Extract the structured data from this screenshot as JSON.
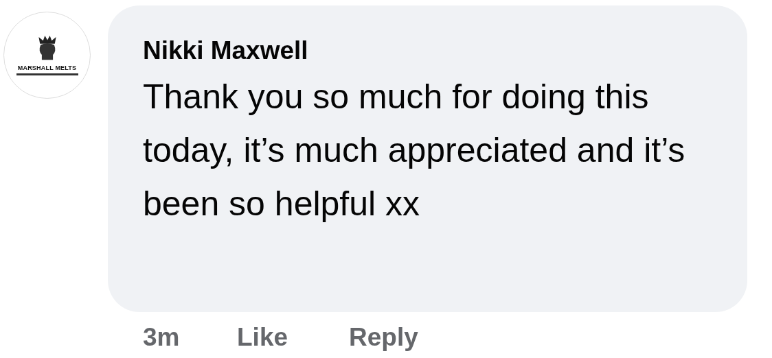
{
  "avatar": {
    "logo_text": "MARSHALL MELTS"
  },
  "comment": {
    "author": "Nikki Maxwell",
    "text": "Thank you so much for doing this today, it’s much appreciated and it’s been so helpful xx"
  },
  "actions": {
    "time": "3m",
    "like": "Like",
    "reply": "Reply"
  }
}
